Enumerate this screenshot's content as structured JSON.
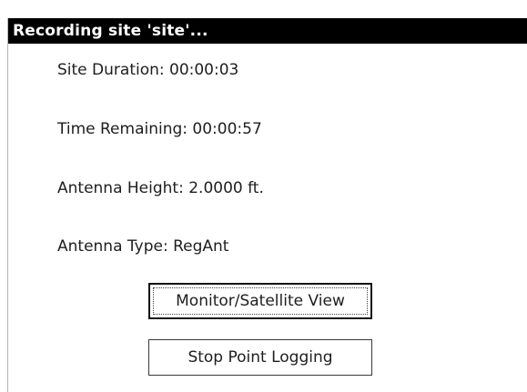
{
  "window": {
    "title": "Recording site 'site'..."
  },
  "info": {
    "site_duration": "Site Duration: 00:00:03",
    "time_remaining": "Time Remaining: 00:00:57",
    "antenna_height": "Antenna Height: 2.0000 ft.",
    "antenna_type": "Antenna Type: RegAnt"
  },
  "buttons": {
    "monitor_label": "Monitor/Satellite View",
    "stop_label": "Stop Point Logging"
  },
  "colors": {
    "titlebar_bg": "#000000",
    "titlebar_text": "#ffffff",
    "background": "#ffffff"
  }
}
